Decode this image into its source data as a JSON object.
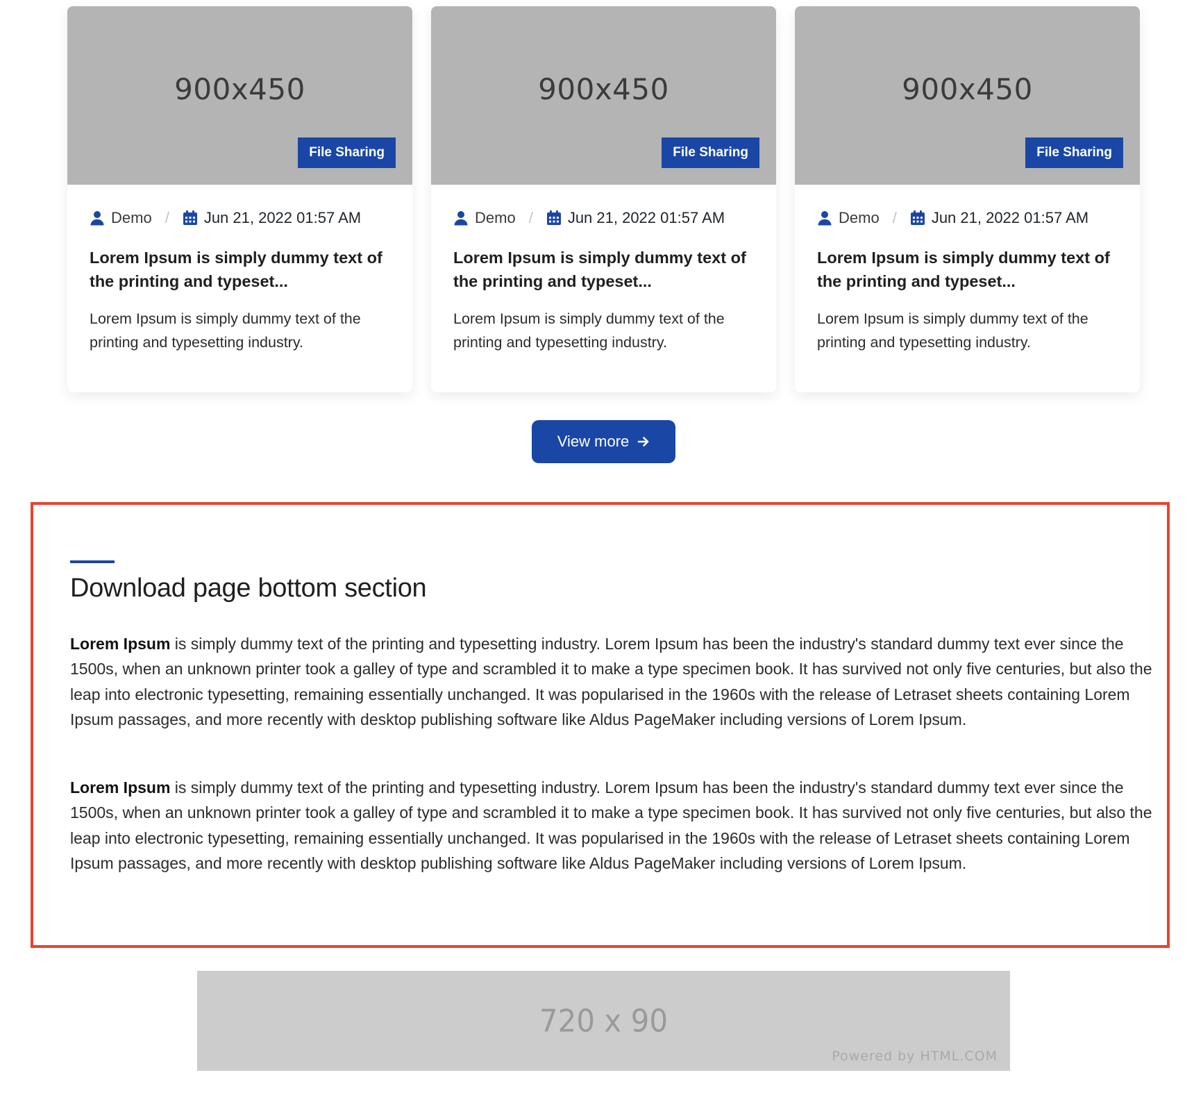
{
  "cards": [
    {
      "thumb_text": "900x450",
      "category": "File Sharing",
      "author": "Demo",
      "date": "Jun 21, 2022 01:57 AM",
      "title": "Lorem Ipsum is simply dummy text of the printing and typeset...",
      "excerpt": "Lorem Ipsum is simply dummy text of the printing and typesetting industry."
    },
    {
      "thumb_text": "900x450",
      "category": "File Sharing",
      "author": "Demo",
      "date": "Jun 21, 2022 01:57 AM",
      "title": "Lorem Ipsum is simply dummy text of the printing and typeset...",
      "excerpt": "Lorem Ipsum is simply dummy text of the printing and typesetting industry."
    },
    {
      "thumb_text": "900x450",
      "category": "File Sharing",
      "author": "Demo",
      "date": "Jun 21, 2022 01:57 AM",
      "title": "Lorem Ipsum is simply dummy text of the printing and typeset...",
      "excerpt": "Lorem Ipsum is simply dummy text of the printing and typesetting industry."
    }
  ],
  "meta_separator": "/",
  "view_more": {
    "label": "View more",
    "icon": "arrow-right-icon"
  },
  "bottom_section": {
    "title": "Download page bottom section",
    "paragraphs": [
      {
        "bold": "Lorem Ipsum",
        "text": " is simply dummy text of the printing and typesetting industry. Lorem Ipsum has been the industry's standard dummy text ever since the 1500s, when an unknown printer took a galley of type and scrambled it to make a type specimen book. It has survived not only five centuries, but also the leap into electronic typesetting, remaining essentially unchanged. It was popularised in the 1960s with the release of Letraset sheets containing Lorem Ipsum passages, and more recently with desktop publishing software like Aldus PageMaker including versions of Lorem Ipsum."
      },
      {
        "bold": "Lorem Ipsum",
        "text": " is simply dummy text of the printing and typesetting industry. Lorem Ipsum has been the industry's standard dummy text ever since the 1500s, when an unknown printer took a galley of type and scrambled it to make a type specimen book. It has survived not only five centuries, but also the leap into electronic typesetting, remaining essentially unchanged. It was popularised in the 1960s with the release of Letraset sheets containing Lorem Ipsum passages, and more recently with desktop publishing software like Aldus PageMaker including versions of Lorem Ipsum."
      }
    ]
  },
  "ad_banner": {
    "size_text": "720 x 90",
    "powered_by": "Powered by HTML.COM"
  },
  "colors": {
    "primary": "#1a47a6",
    "highlight_border": "#e8442e",
    "thumb_bg": "#b4b4b4",
    "ad_bg": "#cccccc"
  },
  "icons": {
    "author": "user-icon",
    "date": "calendar-icon"
  }
}
